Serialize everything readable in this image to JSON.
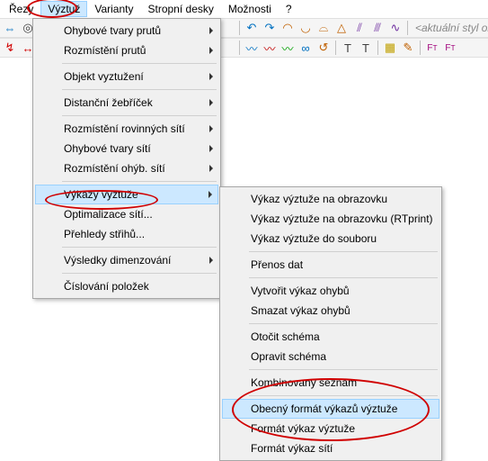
{
  "menubar": {
    "items": [
      "Řezy",
      "Výztuž",
      "Varianty",
      "Stropní desky",
      "Možnosti",
      "?"
    ],
    "open_index": 1
  },
  "toolbar1": {
    "style_label": "<aktuální styl ol"
  },
  "menu1": {
    "items": [
      {
        "label": "Ohybové tvary prutů",
        "arrow": true
      },
      {
        "label": "Rozmístění prutů",
        "arrow": true
      },
      {
        "sep": true
      },
      {
        "label": "Objekt vyztužení",
        "arrow": true
      },
      {
        "sep": true
      },
      {
        "label": "Distanční žebříček",
        "arrow": true
      },
      {
        "sep": true
      },
      {
        "label": "Rozmístění rovinných sítí",
        "arrow": true
      },
      {
        "label": "Ohybové tvary sítí",
        "arrow": true
      },
      {
        "label": "Rozmístění ohýb. sítí",
        "arrow": true
      },
      {
        "sep": true
      },
      {
        "label": "Výkazy výztuže",
        "arrow": true,
        "highlight": true
      },
      {
        "label": "Optimalizace sítí...",
        "arrow": false
      },
      {
        "label": "Přehledy střihů...",
        "arrow": false
      },
      {
        "sep": true
      },
      {
        "label": "Výsledky dimenzování",
        "arrow": true
      },
      {
        "sep": true
      },
      {
        "label": "Číslování položek",
        "arrow": false
      }
    ]
  },
  "menu2": {
    "items": [
      {
        "label": "Výkaz výztuže na obrazovku"
      },
      {
        "label": "Výkaz výztuže na obrazovku (RTprint)"
      },
      {
        "label": "Výkaz výztuže do souboru"
      },
      {
        "sep": true
      },
      {
        "label": "Přenos dat"
      },
      {
        "sep": true
      },
      {
        "label": "Vytvořit výkaz ohybů"
      },
      {
        "label": "Smazat výkaz ohybů"
      },
      {
        "sep": true
      },
      {
        "label": "Otočit schéma"
      },
      {
        "label": "Opravit schéma"
      },
      {
        "sep": true
      },
      {
        "label": "Kombinovaný seznam"
      },
      {
        "sep": true
      },
      {
        "label": "Obecný formát výkazů výztuže",
        "highlight": true
      },
      {
        "label": "Formát výkaz výztuže"
      },
      {
        "label": "Formát výkaz sítí"
      }
    ]
  }
}
